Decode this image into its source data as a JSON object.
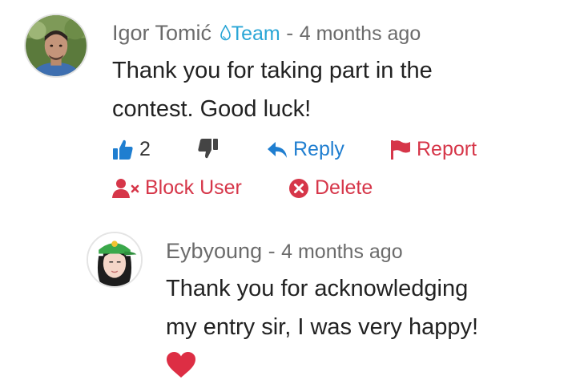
{
  "comments": [
    {
      "author": "Igor Tomić",
      "badge": "Team",
      "separator": "-",
      "time": "4 months ago",
      "text_lines": [
        "Thank you for taking part in the",
        "contest. Good luck!"
      ],
      "likes": "2",
      "actions": {
        "reply": "Reply",
        "report": "Report",
        "block_user": "Block User",
        "delete": "Delete"
      }
    },
    {
      "author": "Eybyoung",
      "separator": "-",
      "time": "4 months ago",
      "text_lines": [
        "Thank you for acknowledging",
        "my entry sir, I was very happy!"
      ],
      "emoji": "heart-emoji"
    }
  ],
  "colors": {
    "link_blue": "#1f7ed0",
    "action_red": "#d63649",
    "team_badge": "#2aa6d6",
    "meta_gray": "#6b6b6b"
  }
}
